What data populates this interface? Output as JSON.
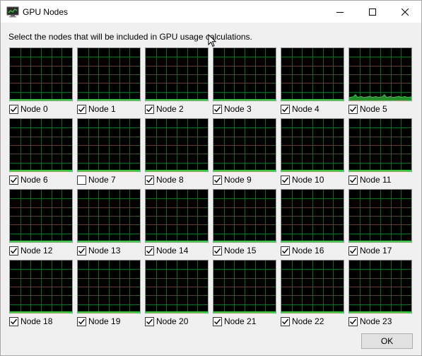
{
  "window": {
    "title": "GPU Nodes",
    "icon": "gpu-monitor-icon",
    "controls": [
      "minimize-icon",
      "maximize-icon",
      "close-icon"
    ]
  },
  "instruction": "Select the nodes that will be included in GPU usage calculations.",
  "graph_colors": {
    "background": "#000000",
    "grid": "#0a6b1a",
    "line": "#22d83a",
    "fill": "#1a8f2a"
  },
  "nodes": [
    {
      "label": "Node 0",
      "checked": true,
      "usage": 0
    },
    {
      "label": "Node 1",
      "checked": true,
      "usage": 0
    },
    {
      "label": "Node 2",
      "checked": true,
      "usage": 0
    },
    {
      "label": "Node 3",
      "checked": true,
      "usage": 0
    },
    {
      "label": "Node 4",
      "checked": true,
      "usage": 0
    },
    {
      "label": "Node 5",
      "checked": true,
      "usage": 7
    },
    {
      "label": "Node 6",
      "checked": true,
      "usage": 0
    },
    {
      "label": "Node 7",
      "checked": false,
      "usage": 0
    },
    {
      "label": "Node 8",
      "checked": true,
      "usage": 0
    },
    {
      "label": "Node 9",
      "checked": true,
      "usage": 0
    },
    {
      "label": "Node 10",
      "checked": true,
      "usage": 0
    },
    {
      "label": "Node 11",
      "checked": true,
      "usage": 0
    },
    {
      "label": "Node 12",
      "checked": true,
      "usage": 0
    },
    {
      "label": "Node 13",
      "checked": true,
      "usage": 0
    },
    {
      "label": "Node 14",
      "checked": true,
      "usage": 0
    },
    {
      "label": "Node 15",
      "checked": true,
      "usage": 0
    },
    {
      "label": "Node 16",
      "checked": true,
      "usage": 0
    },
    {
      "label": "Node 17",
      "checked": true,
      "usage": 0
    },
    {
      "label": "Node 18",
      "checked": true,
      "usage": 0
    },
    {
      "label": "Node 19",
      "checked": true,
      "usage": 0
    },
    {
      "label": "Node 20",
      "checked": true,
      "usage": 0
    },
    {
      "label": "Node 21",
      "checked": true,
      "usage": 0
    },
    {
      "label": "Node 22",
      "checked": true,
      "usage": 0
    },
    {
      "label": "Node 23",
      "checked": true,
      "usage": 0
    }
  ],
  "ok_label": "OK"
}
